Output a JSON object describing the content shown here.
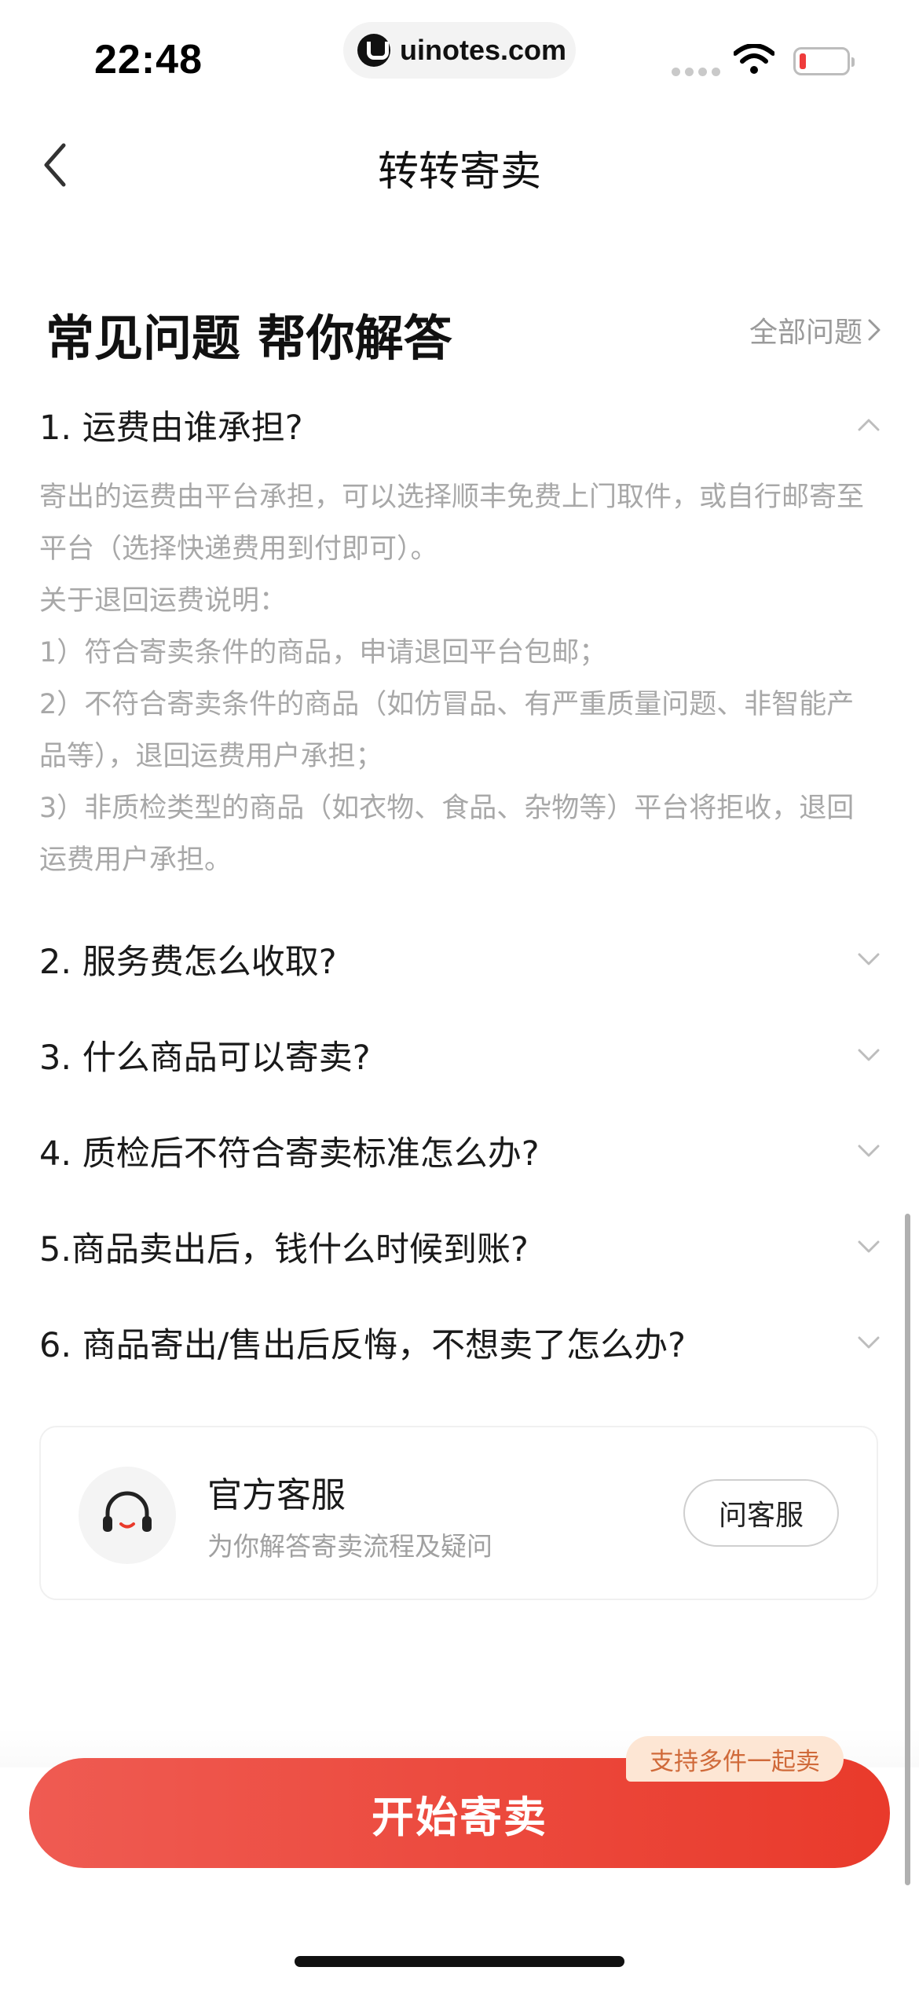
{
  "status_bar": {
    "time": "22:48",
    "url": "uinotes.com"
  },
  "nav": {
    "title": "转转寄卖",
    "back_icon": "chevron-left-icon"
  },
  "faq": {
    "title": "常见问题 帮你解答",
    "all_link": "全部问题",
    "items": [
      {
        "question": "1. 运费由谁承担?",
        "expanded": true,
        "answer": [
          "寄出的运费由平台承担，可以选择顺丰免费上门取件，或自行邮寄至平台（选择快递费用到付即可）。",
          "关于退回运费说明：",
          "1）符合寄卖条件的商品，申请退回平台包邮；",
          "2）不符合寄卖条件的商品（如仿冒品、有严重质量问题、非智能产品等），退回运费用户承担；",
          "3）非质检类型的商品（如衣物、食品、杂物等）平台将拒收，退回运费用户承担。"
        ]
      },
      {
        "question": "2. 服务费怎么收取?",
        "expanded": false
      },
      {
        "question": "3. 什么商品可以寄卖?",
        "expanded": false
      },
      {
        "question": "4. 质检后不符合寄卖标准怎么办?",
        "expanded": false
      },
      {
        "question": "5.商品卖出后，钱什么时候到账?",
        "expanded": false
      },
      {
        "question": "6. 商品寄出/售出后反悔，不想卖了怎么办?",
        "expanded": false
      }
    ]
  },
  "service": {
    "title": "官方客服",
    "subtitle": "为你解答寄卖流程及疑问",
    "button": "问客服",
    "icon": "headset-icon"
  },
  "cta": {
    "label": "开始寄卖",
    "badge": "支持多件一起卖",
    "color_start": "#ef5b52",
    "color_end": "#e93a2b"
  }
}
